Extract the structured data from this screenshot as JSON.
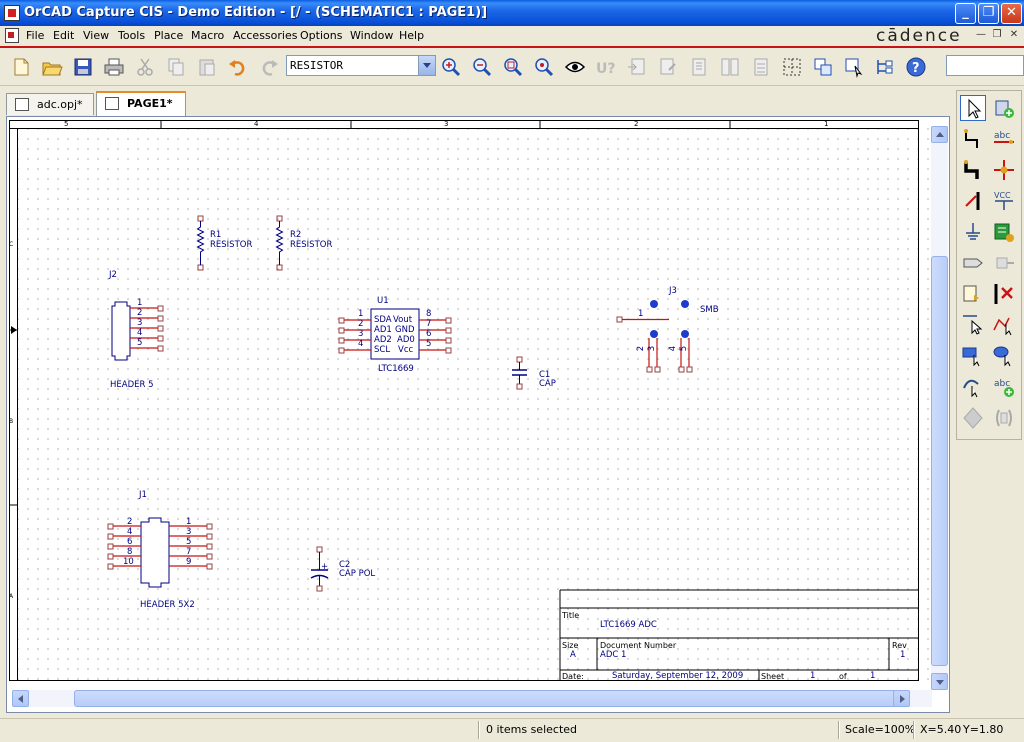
{
  "window": {
    "title": "OrCAD Capture CIS - Demo Edition - [/ - (SCHEMATIC1 : PAGE1)]",
    "minimize": "_",
    "restore": "❐",
    "close": "✕"
  },
  "menu": {
    "items": [
      "File",
      "Edit",
      "View",
      "Tools",
      "Place",
      "Macro",
      "Accessories",
      "Options",
      "Window",
      "Help"
    ],
    "brand": "cādence"
  },
  "toolbar": {
    "part_combo_value": "RESISTOR",
    "icons": [
      "new-icon",
      "open-icon",
      "save-icon",
      "print-icon",
      "cut-icon",
      "copy-icon",
      "paste-icon",
      "undo-icon",
      "redo-icon",
      "zoom-in-icon",
      "zoom-out-icon",
      "zoom-area-icon",
      "zoom-all-icon",
      "eye-icon",
      "annotate-icon",
      "back-annotate-icon",
      "drc-icon",
      "netlist-icon",
      "cross-reference-icon",
      "bom-icon",
      "snap-grid-icon",
      "area-select-icon",
      "drag-connected-icon",
      "project-manager-icon",
      "help-icon"
    ]
  },
  "tabs": [
    {
      "label": "adc.opj*"
    },
    {
      "label": "PAGE1*"
    }
  ],
  "sheet": {
    "column_numbers": [
      "5",
      "4",
      "3",
      "2",
      "1"
    ],
    "row_letters": [
      "C",
      "B",
      "A"
    ]
  },
  "schematic": {
    "r1": {
      "ref": "R1",
      "value": "RESISTOR"
    },
    "r2": {
      "ref": "R2",
      "value": "RESISTOR"
    },
    "j2": {
      "ref": "J2",
      "value": "HEADER 5",
      "pins": [
        "1",
        "2",
        "3",
        "4",
        "5"
      ]
    },
    "u1": {
      "ref": "U1",
      "value": "LTC1669",
      "left_pins": [
        "1",
        "2",
        "3",
        "4"
      ],
      "right_pins": [
        "8",
        "7",
        "6",
        "5"
      ],
      "left_names": [
        "SDA",
        "AD1",
        "AD2",
        "SCL"
      ],
      "right_names": [
        "Vout",
        "GND",
        "AD0",
        "Vcc"
      ]
    },
    "c1": {
      "ref": "C1",
      "value": "CAP"
    },
    "j3": {
      "ref": "J3",
      "value": "SMB",
      "pin1": "1",
      "bottom_pins": [
        "2",
        "3",
        "4",
        "5"
      ]
    },
    "j1": {
      "ref": "J1",
      "value": "HEADER 5X2",
      "left_pins": [
        "2",
        "4",
        "6",
        "8",
        "10"
      ],
      "right_pins": [
        "1",
        "3",
        "5",
        "7",
        "9"
      ]
    },
    "c2": {
      "ref": "C2",
      "value": "CAP POL",
      "plus": "+"
    }
  },
  "title_block": {
    "title_label": "Title",
    "title_value": "LTC1669 ADC",
    "size_label": "Size",
    "size_value": "A",
    "docnum_label": "Document Number",
    "docnum_value": "ADC 1",
    "rev_label": "Rev",
    "rev_value": "1",
    "date_label": "Date:",
    "date_value": "Saturday, September 12, 2009",
    "sheet_label": "Sheet",
    "sheet_num": "1",
    "of_label": "of",
    "sheet_total": "1"
  },
  "palette": {
    "icons": [
      "select-icon",
      "place-part-icon",
      "place-wire-icon",
      "place-net-alias-icon",
      "place-bus-icon",
      "place-junction-icon",
      "place-bus-entry-icon",
      "place-power-icon",
      "place-ground-icon",
      "place-hierarchical-block-icon",
      "place-port-icon",
      "place-pin-icon",
      "place-off-page-connector-icon",
      "place-no-connect-icon",
      "place-line-icon",
      "place-polyline-icon",
      "place-rectangle-icon",
      "place-ellipse-icon",
      "place-arc-icon",
      "place-text-icon",
      "place-ieee-symbol-icon",
      "place-picture-icon"
    ]
  },
  "status": {
    "selection": "0 items selected",
    "scale": "Scale=100%",
    "x": "X=5.40",
    "y": "Y=1.80"
  },
  "colors": {
    "wire": "#c81414",
    "part": "#000080",
    "pin_end": "#9a4040",
    "grid": "#b8b8b8",
    "accent_red": "#c81414",
    "titlebar_blue": "#0850d8"
  }
}
